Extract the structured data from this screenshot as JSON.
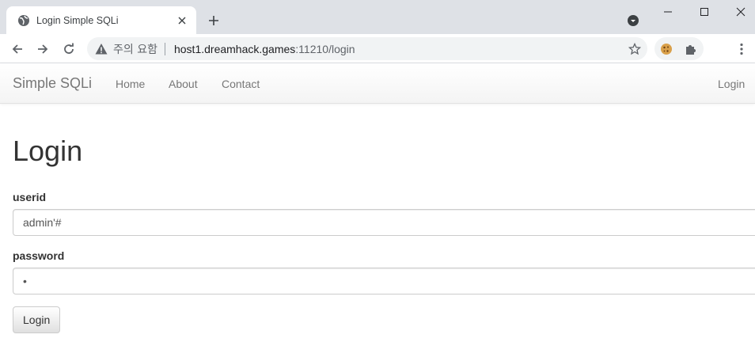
{
  "browser": {
    "tab": {
      "title": "Login Simple SQLi",
      "favicon": "globe-icon"
    },
    "address": {
      "security_label": "주의 요함",
      "url_host": "host1.dreamhack.games",
      "url_rest": ":11210/login"
    },
    "icons": {
      "back": "arrow-left-icon",
      "forward": "arrow-right-icon",
      "reload": "reload-icon",
      "bookmark": "star-icon",
      "extension_cookie": "cookie-icon",
      "extensions": "puzzle-icon",
      "menu": "kebab-menu-icon"
    }
  },
  "site": {
    "brand": "Simple SQLi",
    "nav": [
      {
        "label": "Home"
      },
      {
        "label": "About"
      },
      {
        "label": "Contact"
      }
    ],
    "nav_right": {
      "label": "Login"
    }
  },
  "page": {
    "heading": "Login",
    "userid": {
      "label": "userid",
      "value": "admin'#"
    },
    "password": {
      "label": "password",
      "value": "•"
    },
    "submit_label": "Login"
  },
  "colors": {
    "tabstrip": "#dee1e6",
    "omnibox": "#f1f3f4",
    "nav_text": "#777777",
    "heading_text": "#333333"
  }
}
